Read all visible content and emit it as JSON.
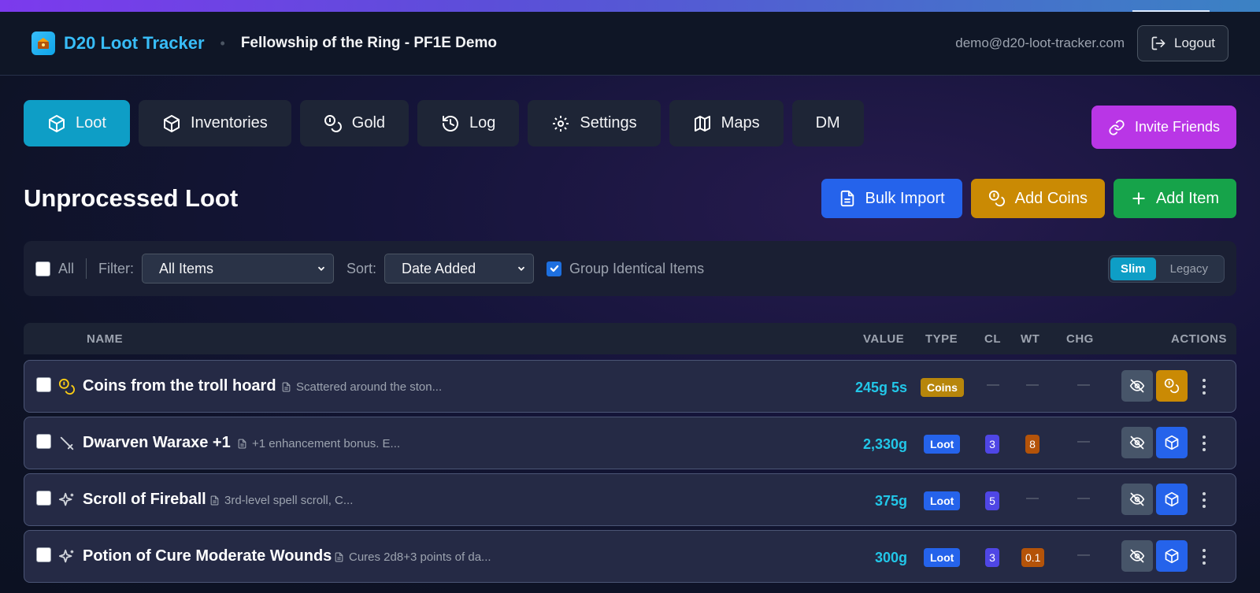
{
  "app": {
    "brand": "D20 Loot Tracker",
    "campaign": "Fellowship of the Ring - PF1E Demo",
    "user_email": "demo@d20-loot-tracker.com",
    "logout_label": "Logout"
  },
  "tabs": [
    {
      "label": "Loot",
      "icon": "box-icon",
      "active": true
    },
    {
      "label": "Inventories",
      "icon": "box-icon"
    },
    {
      "label": "Gold",
      "icon": "coins-icon"
    },
    {
      "label": "Log",
      "icon": "history-icon"
    },
    {
      "label": "Settings",
      "icon": "gear-icon"
    },
    {
      "label": "Maps",
      "icon": "map-icon"
    },
    {
      "label": "DM"
    }
  ],
  "invite_label": "Invite Friends",
  "section": {
    "title": "Unprocessed Loot",
    "bulk_import": "Bulk Import",
    "add_coins": "Add Coins",
    "add_item": "Add Item"
  },
  "filters": {
    "all_label": "All",
    "filter_label": "Filter:",
    "filter_value": "All Items",
    "sort_label": "Sort:",
    "sort_value": "Date Added",
    "group_label": "Group Identical Items",
    "group_checked": true,
    "view_slim": "Slim",
    "view_legacy": "Legacy",
    "view_selected": "Slim"
  },
  "table": {
    "headers": {
      "name": "NAME",
      "value": "VALUE",
      "type": "TYPE",
      "cl": "CL",
      "wt": "WT",
      "chg": "CHG",
      "actions": "ACTIONS"
    },
    "empty_mark": "—",
    "rows": [
      {
        "name": "Coins from the troll hoard",
        "note": "Scattered around the ston...",
        "value": "245g 5s",
        "type": "Coins",
        "cl": "",
        "wt": "",
        "chg": "",
        "icon": "coins-icon",
        "action": "coins-icon"
      },
      {
        "name": "Dwarven Waraxe +1",
        "note": "+1 enhancement bonus. E...",
        "value": "2,330g",
        "type": "Loot",
        "cl": "3",
        "wt": "8",
        "chg": "",
        "icon": "sword-icon",
        "action": "box-icon"
      },
      {
        "name": "Scroll of Fireball",
        "note": "3rd-level spell scroll, C...",
        "value": "375g",
        "type": "Loot",
        "cl": "5",
        "wt": "",
        "chg": "",
        "icon": "sparkles-icon",
        "action": "box-icon"
      },
      {
        "name": "Potion of Cure Moderate Wounds",
        "note": "Cures 2d8+3 points of da...",
        "value": "300g",
        "type": "Loot",
        "cl": "3",
        "wt": "0.1",
        "chg": "",
        "icon": "sparkles-icon",
        "action": "box-icon"
      }
    ]
  },
  "colors": {
    "accent": "#0e9ec6",
    "brand": "#38bdf8",
    "invite": "#b936e6",
    "bulk": "#2563eb",
    "coins": "#ca8a04",
    "add": "#16a34a",
    "value": "#22c7e8"
  }
}
